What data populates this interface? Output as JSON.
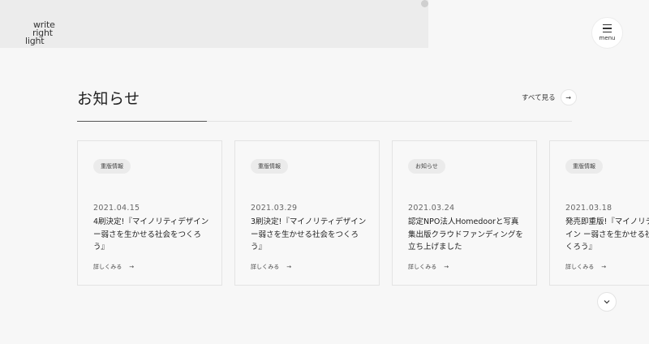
{
  "logo": {
    "line1": "write",
    "line2": "right",
    "line3": "light"
  },
  "menu": {
    "label": "menu"
  },
  "news": {
    "title": "お知らせ",
    "see_all": "すべて見る",
    "cards": [
      {
        "tag": "重版情報",
        "date": "2021.04.15",
        "title": "4刷決定!『マイノリティデザイン ー弱さを生かせる社会をつくろう』",
        "more": "詳しくみる"
      },
      {
        "tag": "重版情報",
        "date": "2021.03.29",
        "title": "3刷決定!『マイノリティデザイン ー弱さを生かせる社会をつくろう』",
        "more": "詳しくみる"
      },
      {
        "tag": "お知らせ",
        "date": "2021.03.24",
        "title": "認定NPO法人Homedoorと写真集出版クラウドファンディングを立ち上げました",
        "more": "詳しくみる"
      },
      {
        "tag": "重版情報",
        "date": "2021.03.18",
        "title": "発売即重版!『マイノリティデザイン ー弱さを生かせる社会をつくろう』",
        "more": "詳しくみる"
      }
    ]
  },
  "icons": {
    "arrow": "arrow-right-icon",
    "chevron": "chevron-down-icon",
    "menu": "hamburger-icon"
  }
}
